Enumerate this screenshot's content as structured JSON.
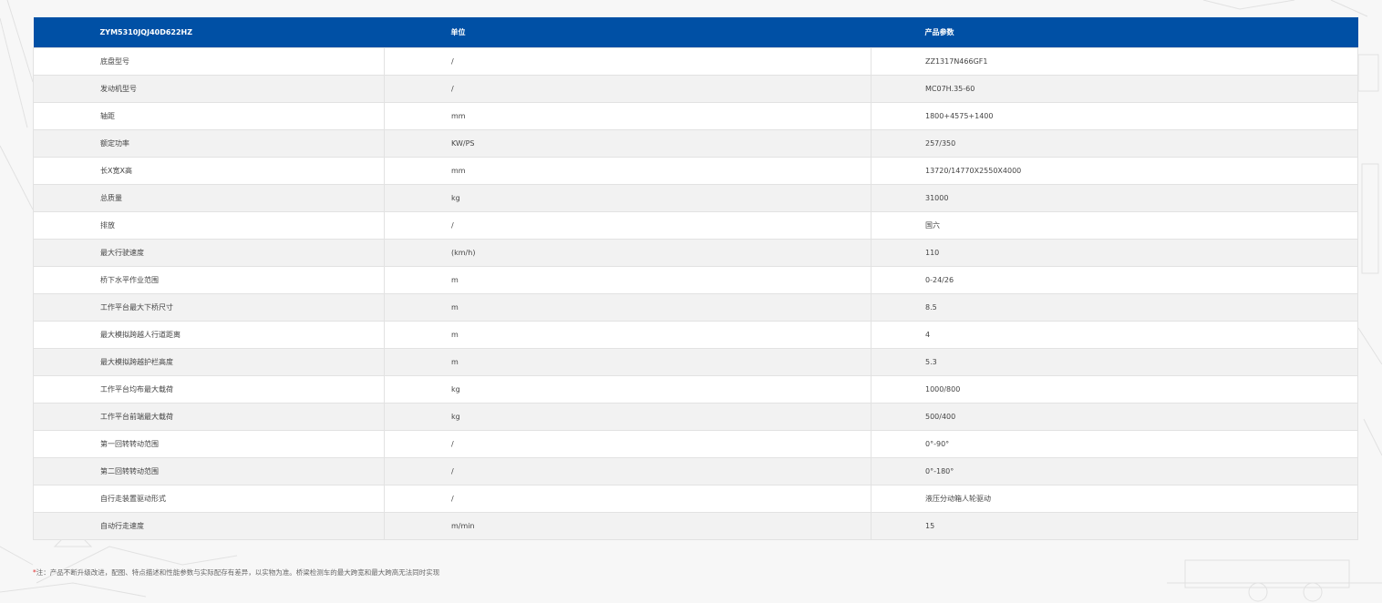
{
  "table": {
    "headers": [
      "ZYM5310JQJ40D622HZ",
      "单位",
      "产品参数"
    ],
    "rows": [
      [
        "底盘型号",
        "/",
        "ZZ1317N466GF1"
      ],
      [
        "发动机型号",
        "/",
        "MC07H.35-60"
      ],
      [
        "轴距",
        "mm",
        "1800+4575+1400"
      ],
      [
        "额定功率",
        "KW/PS",
        "257/350"
      ],
      [
        "长X宽X高",
        "mm",
        "13720/14770X2550X4000"
      ],
      [
        "总质量",
        "kg",
        "31000"
      ],
      [
        "排放",
        "/",
        "国六"
      ],
      [
        "最大行驶速度",
        "(km/h)",
        "110"
      ],
      [
        "桥下水平作业范围",
        "m",
        "0-24/26"
      ],
      [
        "工作平台最大下桥尺寸",
        "m",
        "8.5"
      ],
      [
        "最大模拟跨越人行道距离",
        "m",
        "4"
      ],
      [
        "最大模拟跨越护栏高度",
        "m",
        "5.3"
      ],
      [
        "工作平台均布最大载荷",
        "kg",
        "1000/800"
      ],
      [
        "工作平台前端最大载荷",
        "kg",
        "500/400"
      ],
      [
        "第一回转转动范围",
        "/",
        "0°-90°"
      ],
      [
        "第二回转转动范围",
        "/",
        "0°-180°"
      ],
      [
        "自行走装置驱动形式",
        "/",
        "液压分动箱人轮驱动"
      ],
      [
        "自动行走速度",
        "m/min",
        "15"
      ]
    ]
  },
  "note": {
    "star": "*",
    "text": "注：产品不断升级改进，配图、特点描述和性能参数与实际配存有差异，以实物为准。桥梁检测车的最大跨宽和最大跨高无法同时实现"
  },
  "colors": {
    "header_bg": "#0050a5",
    "page_bg": "#f7f7f7",
    "row_alt": "#f2f2f2"
  }
}
